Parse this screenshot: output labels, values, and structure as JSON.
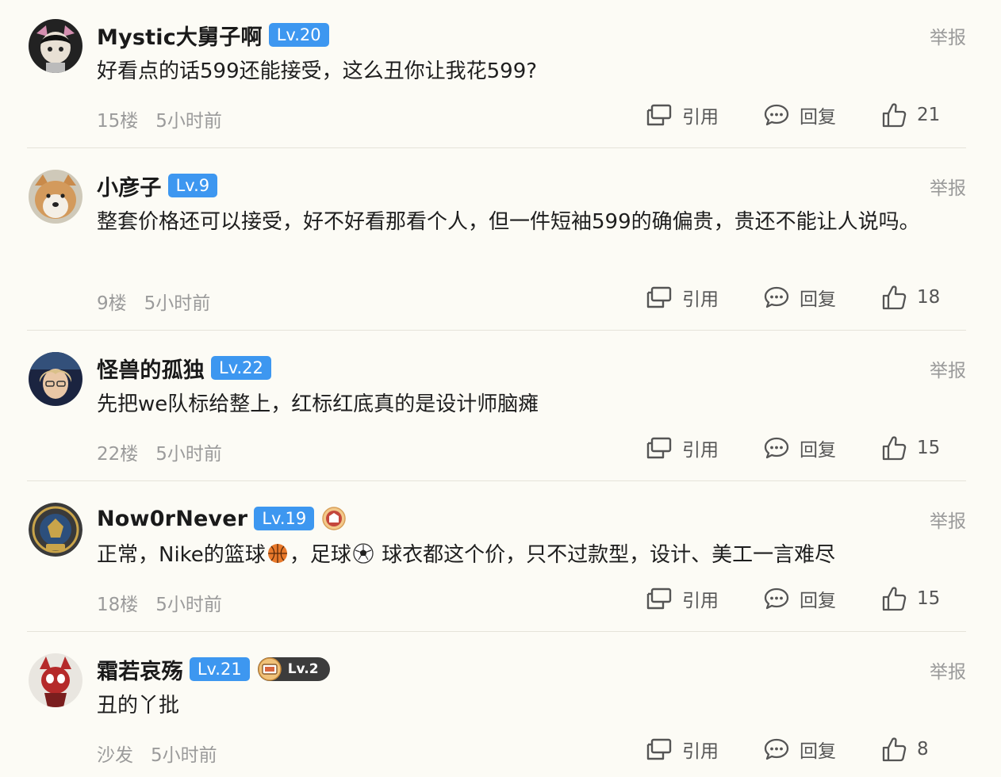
{
  "comments": [
    {
      "username": "Mystic大舅子啊",
      "level": "Lv.20",
      "report": "举报",
      "text": "好看点的话599还能接受，这么丑你让我花599?",
      "floor": "15楼",
      "time": "5小时前",
      "quote": "引用",
      "reply": "回复",
      "likes": "21"
    },
    {
      "username": "小彦子",
      "level": "Lv.9",
      "report": "举报",
      "text": "整套价格还可以接受，好不好看那看个人，但一件短袖599的确偏贵，贵还不能让人说吗。",
      "floor": "9楼",
      "time": "5小时前",
      "quote": "引用",
      "reply": "回复",
      "likes": "18"
    },
    {
      "username": "怪兽的孤独",
      "level": "Lv.22",
      "report": "举报",
      "text": "先把we队标给整上，红标红底真的是设计师脑瘫",
      "floor": "22楼",
      "time": "5小时前",
      "quote": "引用",
      "reply": "回复",
      "likes": "15"
    },
    {
      "username": "Now0rNever",
      "level": "Lv.19",
      "report": "举报",
      "text_parts": [
        "正常，Nike的篮球",
        "，足球",
        " 球衣都这个价，只不过款型，设计、美工一言难尽"
      ],
      "floor": "18楼",
      "time": "5小时前",
      "quote": "引用",
      "reply": "回复",
      "likes": "15"
    },
    {
      "username": "霜若哀殇",
      "level": "Lv.21",
      "extra_badge": "Lv.2",
      "report": "举报",
      "text": "丑的丫批",
      "floor": "沙发",
      "time": "5小时前",
      "quote": "引用",
      "reply": "回复",
      "likes": "8"
    }
  ],
  "icons": {
    "quote": "quote-icon",
    "reply": "comment-bubble-icon",
    "like": "thumbs-up-icon",
    "basketball": "basketball-emoji",
    "soccer": "soccer-ball-emoji"
  },
  "colors": {
    "background": "#fcfbf5",
    "level_badge": "#3d97f0",
    "muted_text": "#9b9b9b"
  }
}
